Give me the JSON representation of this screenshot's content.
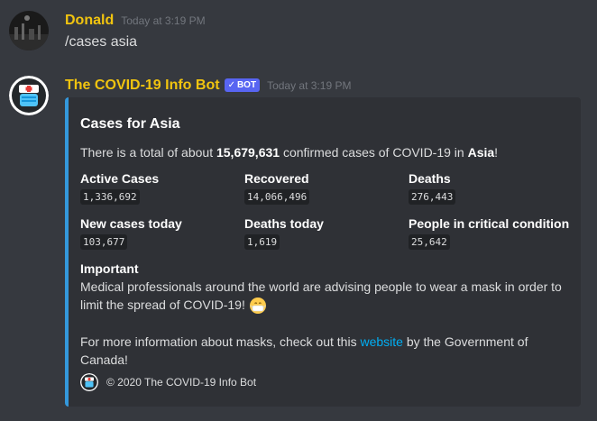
{
  "messages": [
    {
      "author": "Donald",
      "timestamp": "Today at 3:19 PM",
      "content": "/cases asia",
      "avatar_icon": "dark-photo-avatar"
    },
    {
      "author": "The COVID-19 Info Bot",
      "badge": "BOT",
      "badge_check": "✓",
      "timestamp": "Today at 3:19 PM",
      "avatar_icon": "nurse-mask-avatar",
      "embed": {
        "accent_color": "#3498db",
        "title": "Cases for Asia",
        "description": {
          "prefix": "There is a total of about ",
          "total": "15,679,631",
          "middle": " confirmed cases of COVID-19 in ",
          "region": "Asia",
          "suffix": "!"
        },
        "fields": [
          {
            "name": "Active Cases",
            "value": "1,336,692"
          },
          {
            "name": "Recovered",
            "value": "14,066,496"
          },
          {
            "name": "Deaths",
            "value": "276,443"
          },
          {
            "name": "New cases today",
            "value": "103,677"
          },
          {
            "name": "Deaths today",
            "value": "1,619"
          },
          {
            "name": "People in critical condition",
            "value": "25,642"
          }
        ],
        "important": {
          "name": "Important",
          "text": "Medical professionals around the world are advising people to wear a mask in order to limit the spread of COVID-19!",
          "emoji": "mask-face-emoji",
          "more_prefix": "For more information about masks, check out this ",
          "link_text": "website",
          "more_suffix": " by the Government of Canada!"
        },
        "footer": "© 2020 The COVID-19 Info Bot"
      }
    }
  ],
  "colors": {
    "background": "#36393f",
    "embed_background": "#2f3136",
    "username_color": "#f1c40f",
    "bot_badge": "#5865f2",
    "link": "#00aff4"
  }
}
